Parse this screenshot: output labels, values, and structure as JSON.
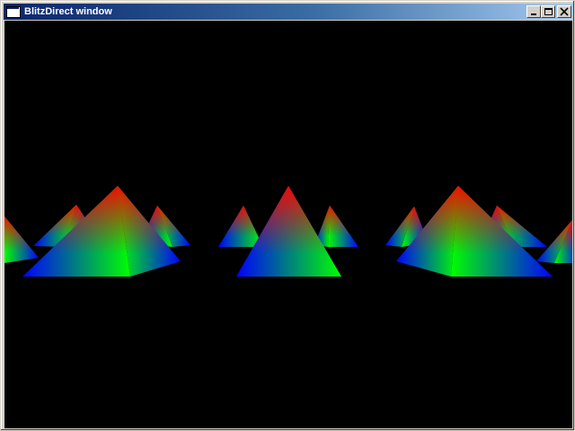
{
  "window": {
    "title": "BlitzDirect window",
    "icon": "app-window-icon"
  },
  "controls": {
    "minimize_icon": "minimize-icon",
    "maximize_icon": "maximize-icon",
    "close_icon": "close-icon"
  },
  "scene": {
    "background": "#000000",
    "colors": {
      "red": "#ff0000",
      "green": "#00ff00",
      "blue": "#0000ff"
    },
    "object": "rgb-pyramid"
  }
}
